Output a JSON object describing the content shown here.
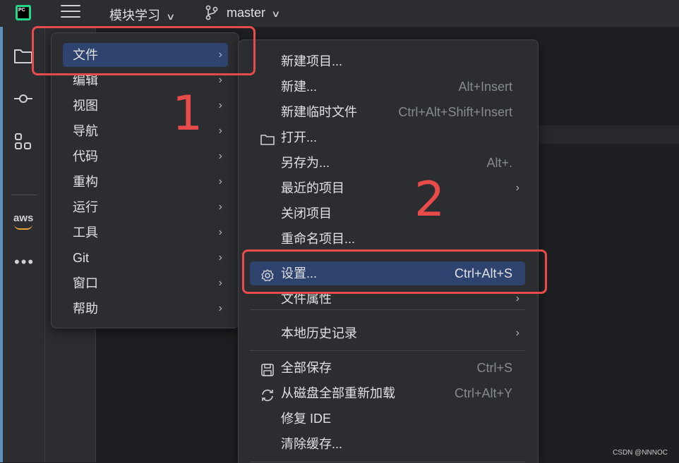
{
  "titlebar": {
    "logo_text": "PC",
    "project_name": "模块学习",
    "branch_name": "master",
    "chevron": "∨"
  },
  "toolstrip": {
    "icons": [
      "folder-icon",
      "commit-icon",
      "structure-icon",
      "aws-icon",
      "more-icon"
    ],
    "aws_label": "aws",
    "more_label": "•••"
  },
  "main_menu": {
    "items": [
      {
        "label": "文件",
        "active": true
      },
      {
        "label": "编辑"
      },
      {
        "label": "视图"
      },
      {
        "label": "导航"
      },
      {
        "label": "代码"
      },
      {
        "label": "重构"
      },
      {
        "label": "运行"
      },
      {
        "label": "工具"
      },
      {
        "label": "Git"
      },
      {
        "label": "窗口"
      },
      {
        "label": "帮助"
      }
    ],
    "arrow": "›"
  },
  "file_menu": {
    "items": [
      {
        "label": "新建项目...",
        "shortcut": ""
      },
      {
        "label": "新建...",
        "shortcut": "Alt+Insert"
      },
      {
        "label": "新建临时文件",
        "shortcut": "Ctrl+Alt+Shift+Insert"
      },
      {
        "label": "打开...",
        "shortcut": "",
        "icon": "folder-icon"
      },
      {
        "label": "另存为...",
        "shortcut": "Alt+."
      },
      {
        "label": "最近的项目",
        "submenu": true
      },
      {
        "label": "关闭项目",
        "shortcut": ""
      },
      {
        "label": "重命名项目...",
        "shortcut": ""
      },
      {
        "label": "设置...",
        "shortcut": "Ctrl+Alt+S",
        "icon": "gear-icon",
        "active": true
      },
      {
        "label": "文件属性",
        "submenu": true
      },
      {
        "label": "本地历史记录",
        "submenu": true
      },
      {
        "label": "全部保存",
        "shortcut": "Ctrl+S",
        "icon": "save-icon"
      },
      {
        "label": "从磁盘全部重新加载",
        "shortcut": "Ctrl+Alt+Y",
        "icon": "reload-icon"
      },
      {
        "label": "修复 IDE",
        "shortcut": ""
      },
      {
        "label": "清除缓存...",
        "shortcut": ""
      }
    ],
    "arrow": "›"
  },
  "annotations": {
    "step1": "1",
    "step2": "2",
    "color": "#e94b4b"
  },
  "watermark": "CSDN @NNNOC",
  "colors": {
    "background": "#1e1f22",
    "panel": "#2b2d30",
    "selection": "#2e436e",
    "text": "#dfe1e5",
    "shortcut_text": "#868a91"
  }
}
